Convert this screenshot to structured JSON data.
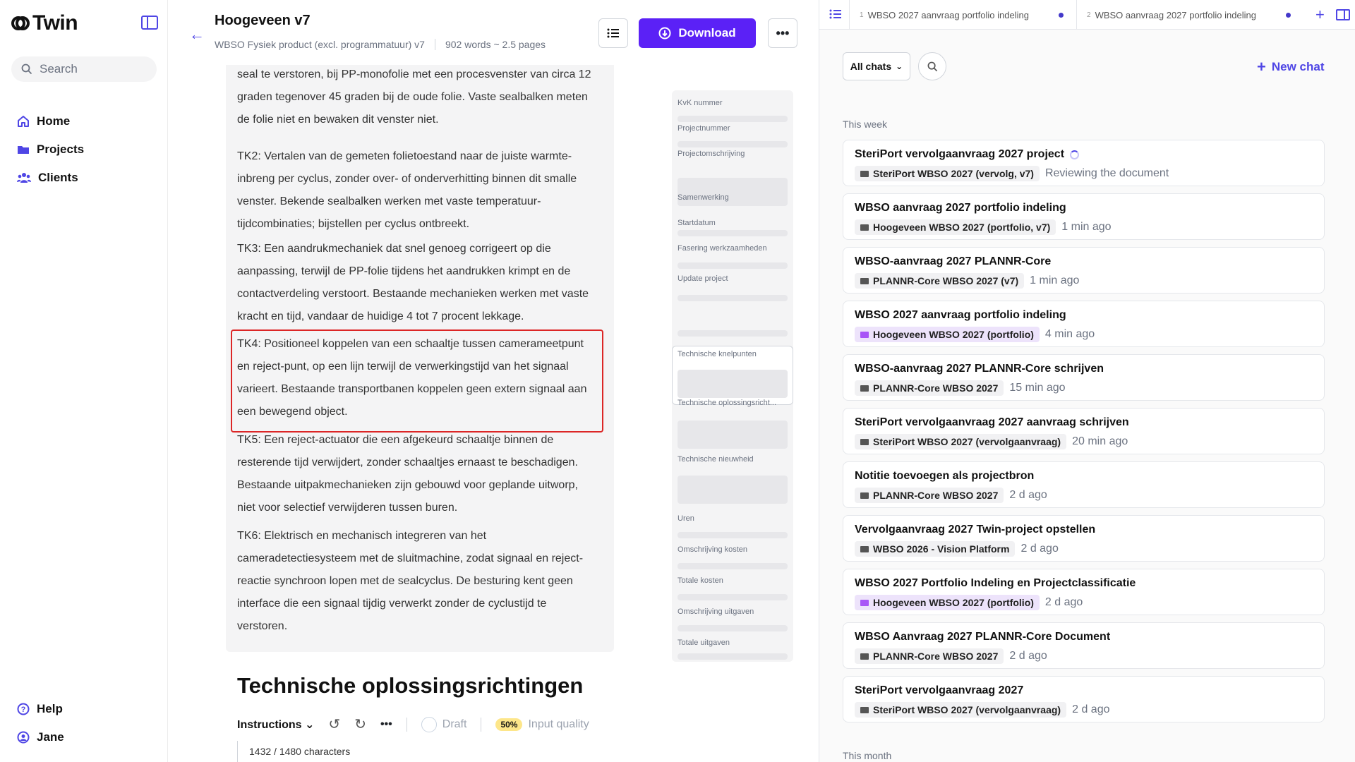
{
  "sidebar": {
    "app_name": "Twin",
    "search_placeholder": "Search",
    "nav": [
      {
        "label": "Home",
        "icon": "home-icon"
      },
      {
        "label": "Projects",
        "icon": "folder-icon"
      },
      {
        "label": "Clients",
        "icon": "users-icon"
      }
    ],
    "footer": [
      {
        "label": "Help",
        "icon": "help-icon"
      },
      {
        "label": "Jane",
        "icon": "user-icon"
      }
    ]
  },
  "document": {
    "title": "Hoogeveen v7",
    "subtitle": "WBSO Fysiek product (excl. programmatuur) v7",
    "word_count": "902 words ~ 2.5 pages",
    "download_label": "Download",
    "paragraphs": [
      "seal te verstoren, bij PP-monofolie met een procesvenster van circa 12 graden tegenover 45 graden bij de oude folie. Vaste sealbalken meten de folie niet en bewaken dit venster niet.",
      "TK2: Vertalen van de gemeten folietoestand naar de juiste warmte-inbreng per cyclus, zonder over- of onderverhitting binnen dit smalle venster. Bekende sealbalken werken met vaste temperatuur-tijdcombinaties; bijstellen per cyclus ontbreekt.",
      "TK3: Een aandrukmechaniek dat snel genoeg corrigeert op die aanpassing, terwijl de PP-folie tijdens het aandrukken krimpt en de contactverdeling verstoort. Bestaande mechanieken werken met vaste kracht en tijd, vandaar de huidige 4 tot 7 procent lekkage.",
      "TK4: Positioneel koppelen van een schaaltje tussen camerameetpunt en reject-punt, op een lijn terwijl de verwerkingstijd van het signaal varieert. Bestaande transportbanen koppelen geen extern signaal aan een bewegend object.",
      "TK5: Een reject-actuator die een afgekeurd schaaltje binnen de resterende tijd verwijdert, zonder schaaltjes ernaast te beschadigen. Bestaande uitpakmechanieken zijn gebouwd voor geplande uitworp, niet voor selectief verwijderen tussen buren.",
      "TK6: Elektrisch en mechanisch integreren van het cameradetectiesysteem met de sluitmachine, zodat signaal en reject-reactie synchroon lopen met de sealcyclus. De besturing kent geen interface die een signaal tijdig verwerkt zonder de cyclustijd te verstoren."
    ],
    "section_title": "Technische oplossingsrichtingen",
    "instructions_label": "Instructions",
    "draft_label": "Draft",
    "quality_badge": "50%",
    "quality_label": "Input quality",
    "char_count": "1432 / 1480 characters"
  },
  "outline": [
    "KvK nummer",
    "Projectnummer",
    "Projectomschrijving",
    "Samenwerking",
    "Startdatum",
    "Fasering werkzaamheden",
    "Update project",
    "Technische knelpunten",
    "Technische oplossingsricht...",
    "Technische nieuwheid",
    "Uren",
    "Omschrijving kosten",
    "Totale kosten",
    "Omschrijving uitgaven",
    "Totale uitgaven"
  ],
  "chat_panel": {
    "tabs": [
      {
        "num": "1",
        "label": "WBSO 2027 aanvraag portfolio indeling"
      },
      {
        "num": "2",
        "label": "WBSO aanvraag 2027 portfolio indeling"
      }
    ],
    "filter_label": "All chats",
    "new_chat_label": "New chat",
    "group_this_week": "This week",
    "group_this_month": "This month",
    "chats": [
      {
        "title": "SteriPort vervolgaanvraag 2027 project",
        "tag": "SteriPort WBSO 2027 (vervolg, v7)",
        "tag_style": "gray",
        "time": "Reviewing the document",
        "loading": true
      },
      {
        "title": "WBSO aanvraag 2027 portfolio indeling",
        "tag": "Hoogeveen WBSO 2027 (portfolio, v7)",
        "tag_style": "gray",
        "time": "1 min ago"
      },
      {
        "title": "WBSO-aanvraag 2027 PLANNR-Core",
        "tag": "PLANNR-Core WBSO 2027 (v7)",
        "tag_style": "gray",
        "time": "1 min ago"
      },
      {
        "title": "WBSO 2027 aanvraag portfolio indeling",
        "tag": "Hoogeveen WBSO 2027 (portfolio)",
        "tag_style": "purple",
        "time": "4 min ago"
      },
      {
        "title": "WBSO-aanvraag 2027 PLANNR-Core schrijven",
        "tag": "PLANNR-Core WBSO 2027",
        "tag_style": "gray",
        "time": "15 min ago"
      },
      {
        "title": "SteriPort vervolgaanvraag 2027 aanvraag schrijven",
        "tag": "SteriPort WBSO 2027 (vervolgaanvraag)",
        "tag_style": "gray",
        "time": "20 min ago"
      },
      {
        "title": "Notitie toevoegen als projectbron",
        "tag": "PLANNR-Core WBSO 2027",
        "tag_style": "gray",
        "time": "2 d ago"
      },
      {
        "title": "Vervolgaanvraag 2027 Twin-project opstellen",
        "tag": "WBSO 2026 - Vision Platform",
        "tag_style": "gray",
        "time": "2 d ago"
      },
      {
        "title": "WBSO 2027 Portfolio Indeling en Projectclassificatie",
        "tag": "Hoogeveen WBSO 2027 (portfolio)",
        "tag_style": "purple",
        "time": "2 d ago"
      },
      {
        "title": "WBSO Aanvraag 2027 PLANNR-Core Document",
        "tag": "PLANNR-Core WBSO 2027",
        "tag_style": "gray",
        "time": "2 d ago"
      },
      {
        "title": "SteriPort vervolgaanvraag 2027",
        "tag": "SteriPort WBSO 2027 (vervolgaanvraag)",
        "tag_style": "gray",
        "time": "2 d ago"
      }
    ]
  },
  "colors": {
    "accent": "#5b21f6",
    "highlight_border": "#dc2626",
    "badge": "#fde68a"
  }
}
